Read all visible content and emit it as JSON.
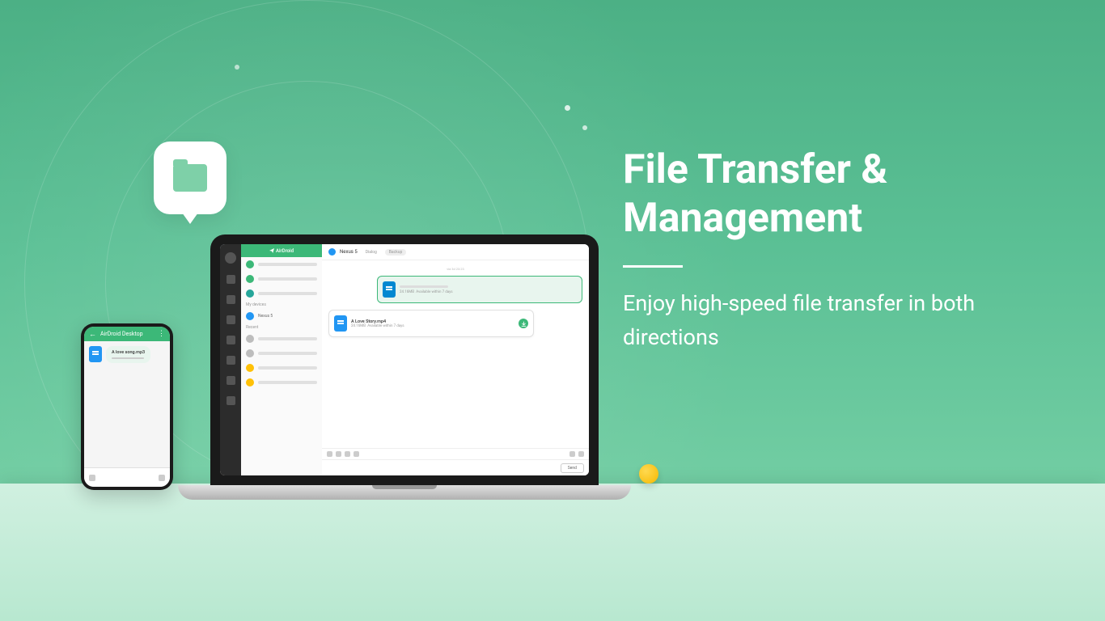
{
  "hero": {
    "title_line1": "File Transfer &",
    "title_line2": "Management",
    "subtitle": "Enjoy high-speed file transfer in both directions"
  },
  "laptop": {
    "app_name": "AirDroid",
    "device_name": "Nexus 5",
    "tabs": {
      "dialog": "Dialog",
      "backup": "Backup"
    },
    "sections": {
      "my_devices": "My devices",
      "recent": "Recent"
    },
    "timestamp": "via 3d 23:23",
    "sent_file": {
      "size": "24.16MB",
      "availability": "Available within 7 days"
    },
    "received_file": {
      "name": "A Love Story.mp4",
      "size": "24.16MB",
      "availability": "Available within 7 days"
    },
    "send_button": "Send"
  },
  "phone": {
    "header_title": "AirDroid Desktop",
    "file_name": "A love song.mp3"
  }
}
